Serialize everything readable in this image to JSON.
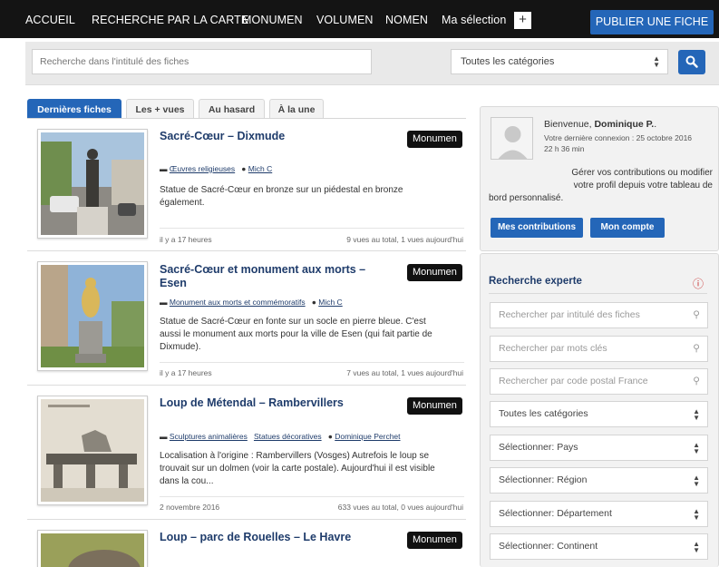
{
  "nav": {
    "items": [
      {
        "label": "ACCUEIL"
      },
      {
        "label": "RECHERCHE PAR LA CARTE"
      },
      {
        "label": "MONUMEN"
      },
      {
        "label": "VOLUMEN"
      },
      {
        "label": "NOMEN"
      },
      {
        "label": "Ma sélection"
      }
    ],
    "plus_label": "+",
    "publish_label": "PUBLIER UNE FICHE"
  },
  "search": {
    "placeholder": "Recherche dans l'intitulé des fiches",
    "category_value": "Toutes les catégories"
  },
  "tabs": [
    {
      "label": "Dernières fiches"
    },
    {
      "label": "Les + vues"
    },
    {
      "label": "Au hasard"
    },
    {
      "label": "À la une"
    }
  ],
  "entries": [
    {
      "title_lines": [
        "Sacré-Cœur – Dixmude"
      ],
      "badge": "Monumen",
      "categories": [
        "Œuvres religieuses"
      ],
      "author": "Mich C",
      "description_lines": [
        "Statue de Sacré-Cœur en bronze sur un piédestal en bronze",
        "également."
      ],
      "date": "il y a 17 heures",
      "views": "9 vues au total, 1 vues aujourd'hui"
    },
    {
      "title_lines": [
        "Sacré-Cœur et monument aux morts –",
        "Esen"
      ],
      "badge": "Monumen",
      "categories": [
        "Monument aux morts et commémoratifs"
      ],
      "author": "Mich C",
      "description_lines": [
        "Statue de Sacré-Cœur en fonte sur un socle en pierre bleue. C'est",
        "aussi le monument aux morts pour la ville de Esen (qui fait partie de",
        "Dixmude)."
      ],
      "date": "il y a 17 heures",
      "views": "7 vues au total, 1 vues aujourd'hui"
    },
    {
      "title_lines": [
        "Loup de Métendal – Rambervillers"
      ],
      "badge": "Monumen",
      "categories": [
        "Sculptures animalières",
        "Statues décoratives"
      ],
      "author": "Dominique Perchet",
      "description_lines": [
        "Localisation à l'origine : Rambervillers (Vosges) Autrefois le loup se",
        "trouvait sur un dolmen (voir la carte postale). Aujourd'hui il est visible",
        "dans la cou..."
      ],
      "date": "2 novembre 2016",
      "views": "633 vues au total, 0 vues aujourd'hui"
    },
    {
      "title_lines": [
        "Loup – parc de Rouelles – Le Havre"
      ],
      "badge": "Monumen"
    }
  ],
  "welcome": {
    "greeting_prefix": "Bienvenue, ",
    "user_name": "Dominique P.",
    "greeting_suffix": ".",
    "last_login_line1": "Votre dernière connexion : 25 octobre 2016",
    "last_login_line2": "22 h 36 min",
    "manage_line1": "Gérer vos contributions ou modifier",
    "manage_line2": "votre profil depuis votre tableau de",
    "manage_line3": "bord personnalisé.",
    "contributions_label": "Mes contributions",
    "account_label": "Mon compte"
  },
  "expert": {
    "title": "Recherche experte",
    "info_icon": "info-icon",
    "text_fields": [
      {
        "placeholder": "Rechercher par intitulé des fiches"
      },
      {
        "placeholder": "Rechercher par mots clés"
      },
      {
        "placeholder": "Rechercher par code postal France"
      }
    ],
    "selects": [
      {
        "value": "Toutes les catégories"
      },
      {
        "value": "Sélectionner: Pays"
      },
      {
        "value": "Sélectionner: Région"
      },
      {
        "value": "Sélectionner: Département"
      },
      {
        "value": "Sélectionner: Continent"
      }
    ]
  },
  "colors": {
    "nav_bg": "#141414",
    "accent_blue": "#2466b8",
    "title_blue": "#1f3c6b",
    "badge_black": "#111111",
    "info_red": "#c62828"
  }
}
